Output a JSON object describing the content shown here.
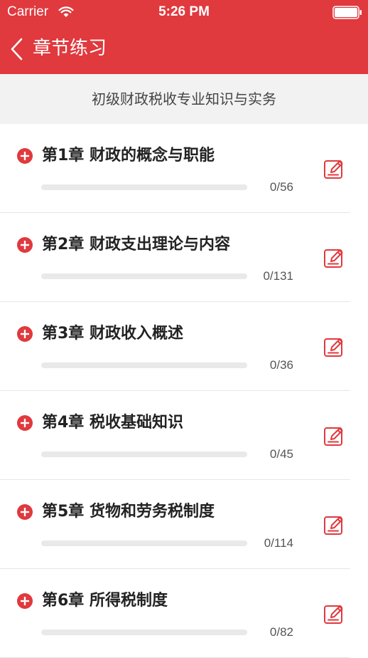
{
  "status_bar": {
    "carrier": "Carrier",
    "time": "5:26 PM",
    "wifi_icon": "wifi-icon",
    "battery_icon": "battery-icon"
  },
  "nav": {
    "title": "章节练习",
    "back_icon": "chevron-left-icon"
  },
  "subheader": {
    "text": "初级财政税收专业知识与实务"
  },
  "colors": {
    "brand": "#e0393e",
    "subheader_bg": "#f2f2f2",
    "progress_track": "#e9e9e9"
  },
  "chapters": [
    {
      "title": "第1章 财政的概念与职能",
      "count": "0/56",
      "progress": 0
    },
    {
      "title": "第2章 财政支出理论与内容",
      "count": "0/131",
      "progress": 0
    },
    {
      "title": "第3章 财政收入概述",
      "count": "0/36",
      "progress": 0
    },
    {
      "title": "第4章 税收基础知识",
      "count": "0/45",
      "progress": 0
    },
    {
      "title": "第5章 货物和劳务税制度",
      "count": "0/114",
      "progress": 0
    },
    {
      "title": "第6章 所得税制度",
      "count": "0/82",
      "progress": 0
    }
  ]
}
